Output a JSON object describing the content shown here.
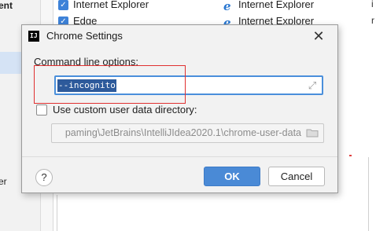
{
  "background": {
    "sidebar_top_label": "ent",
    "sidebar_bottom_label": "er",
    "rows": [
      {
        "name": "Internet Explorer",
        "type": "Internet Explorer",
        "trailing": "i"
      },
      {
        "name": "Edge",
        "type": "Internet Explorer",
        "trailing": "r"
      }
    ]
  },
  "dialog": {
    "title": "Chrome Settings",
    "command_line_label": "Command line options:",
    "command_line_value": "--incognito",
    "use_custom_dir_label": "Use custom user data directory:",
    "custom_dir_value": "paming\\JetBrains\\IntelliJIdea2020.1\\chrome-user-data",
    "custom_dir_checked": false,
    "help_label": "?",
    "ok_label": "OK",
    "cancel_label": "Cancel"
  },
  "colors": {
    "accent": "#4a8ad6",
    "selection": "#2d5a9b",
    "highlight_box": "#e03030"
  }
}
